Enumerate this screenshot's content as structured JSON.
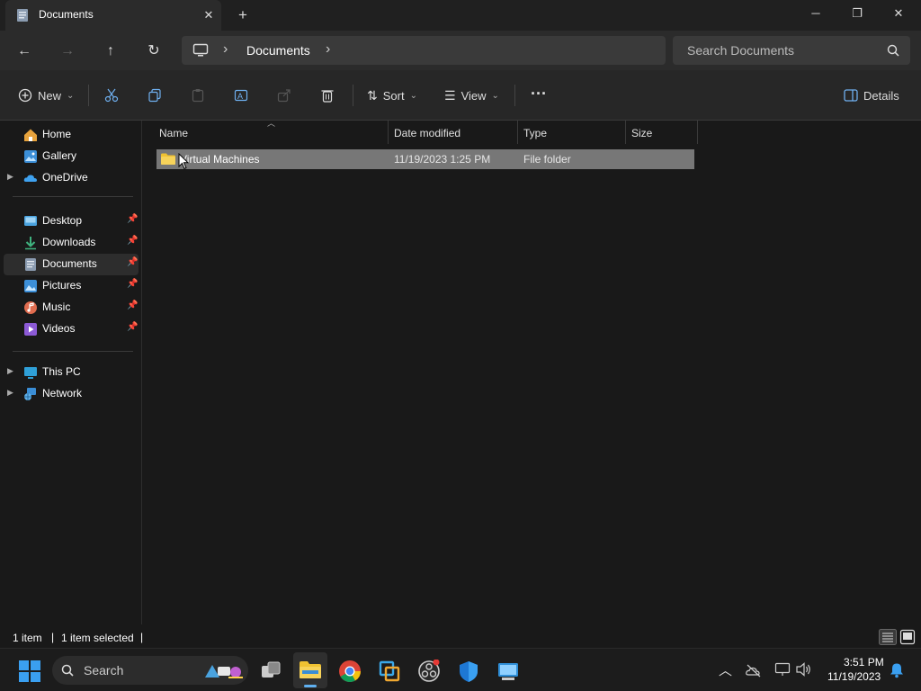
{
  "window": {
    "tab_title": "Documents",
    "tab_close_icon": "✕",
    "new_tab_icon": "+",
    "minimize_icon": "─",
    "maximize_icon": "❐",
    "close_icon": "✕"
  },
  "nav": {
    "back_icon": "←",
    "forward_icon": "→",
    "up_icon": "↑",
    "refresh_icon": "↻",
    "breadcrumb": {
      "separator": "›",
      "items": [
        "Documents"
      ],
      "trailing_separator": "›"
    },
    "search_placeholder": "Search Documents"
  },
  "toolbar": {
    "new_label": "New",
    "sort_label": "Sort",
    "view_label": "View",
    "more_label": "···",
    "details_label": "Details",
    "dropdown_icon": "⌄"
  },
  "sidebar": {
    "quick": [
      {
        "label": "Home",
        "icon": "home-icon",
        "color": "#e8a33d"
      },
      {
        "label": "Gallery",
        "icon": "gallery-icon",
        "color": "#3c8fd8"
      },
      {
        "label": "OneDrive",
        "icon": "cloud-icon",
        "color": "#3fa2f0",
        "expandable": true
      }
    ],
    "pinned": [
      {
        "label": "Desktop",
        "icon": "desktop-icon",
        "color": "#4aa3df"
      },
      {
        "label": "Downloads",
        "icon": "download-icon",
        "color": "#3fb37f"
      },
      {
        "label": "Documents",
        "icon": "document-icon",
        "color": "#8a9bb0",
        "selected": true
      },
      {
        "label": "Pictures",
        "icon": "pictures-icon",
        "color": "#3c8fd8"
      },
      {
        "label": "Music",
        "icon": "music-icon",
        "color": "#e06c4f"
      },
      {
        "label": "Videos",
        "icon": "videos-icon",
        "color": "#8c5ad6"
      }
    ],
    "devices": [
      {
        "label": "This PC",
        "icon": "pc-icon",
        "color": "#2fa0d8"
      },
      {
        "label": "Network",
        "icon": "network-icon",
        "color": "#3a8ed6"
      }
    ]
  },
  "columns": [
    "Name",
    "Date modified",
    "Type",
    "Size"
  ],
  "files": [
    {
      "name": "Virtual Machines",
      "date": "11/19/2023 1:25 PM",
      "type": "File folder",
      "size": ""
    }
  ],
  "status": {
    "count": "1 item",
    "sep": "|",
    "selected": "1 item selected"
  },
  "taskbar": {
    "search_label": "Search",
    "time": "3:51 PM",
    "date": "11/19/2023",
    "colors": {
      "start": "#3a9ff0",
      "explorer": "#f0c232",
      "chrome_red": "#db4437",
      "chrome_yellow": "#f4c20d",
      "chrome_green": "#0f9d58",
      "chrome_blue": "#4285f4"
    }
  }
}
